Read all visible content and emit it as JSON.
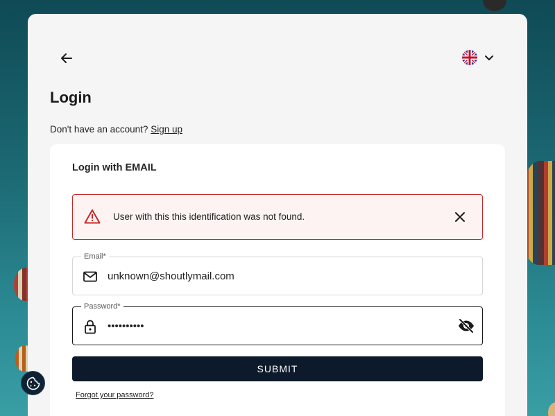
{
  "header": {
    "title": "Login",
    "signup_prompt": "Don't have an account?",
    "signup_link": "Sign up",
    "language_flag": "uk-flag-icon"
  },
  "panel": {
    "title": "Login with EMAIL",
    "alert": {
      "message": "User with this this identification was not found.",
      "color": "#c62828"
    },
    "email": {
      "label": "Email*",
      "value": "unknown@shoutlymail.com",
      "icon": "mail-icon"
    },
    "password": {
      "label": "Password*",
      "value": "••••••••••",
      "icon": "lock-icon",
      "toggle_icon": "eye-off-icon"
    },
    "submit_label": "SUBMIT",
    "forgot_label": "Forgot your password?"
  },
  "colors": {
    "primary": "#0c1a2b",
    "error": "#c62828",
    "card_bg": "#f5f5f5"
  },
  "cookie_icon": "cookie-icon"
}
